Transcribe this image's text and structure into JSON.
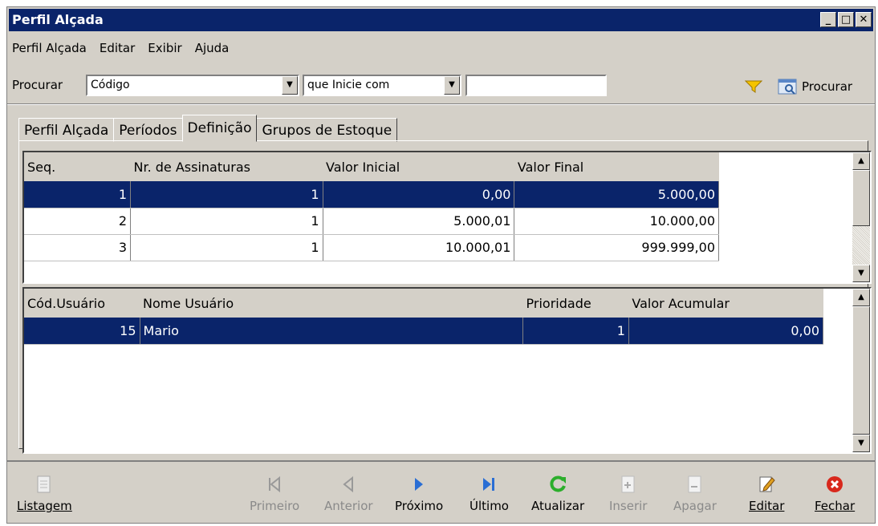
{
  "window": {
    "title": "Perfil Alçada"
  },
  "menu": {
    "items": [
      "Perfil Alçada",
      "Editar",
      "Exibir",
      "Ajuda"
    ]
  },
  "search": {
    "label": "Procurar",
    "field": "Código",
    "mode": "que Inicie com",
    "value": "",
    "button": "Procurar"
  },
  "tabs": [
    "Perfil Alçada",
    "Períodos",
    "Definição",
    "Grupos de Estoque"
  ],
  "active_tab": "Definição",
  "grid1": {
    "columns": [
      "Seq.",
      "Nr. de Assinaturas",
      "Valor Inicial",
      "Valor Final"
    ],
    "rows": [
      [
        "1",
        "1",
        "0,00",
        "5.000,00"
      ],
      [
        "2",
        "1",
        "5.000,01",
        "10.000,00"
      ],
      [
        "3",
        "1",
        "10.000,01",
        "999.999,00"
      ]
    ]
  },
  "grid2": {
    "columns": [
      "Cód.Usuário",
      "Nome Usuário",
      "Prioridade",
      "Valor Acumular"
    ],
    "rows": [
      [
        "15",
        "Mario",
        "1",
        "0,00"
      ]
    ]
  },
  "toolbar": {
    "listagem": "Listagem",
    "primeiro": "Primeiro",
    "anterior": "Anterior",
    "proximo": "Próximo",
    "ultimo": "Último",
    "atualizar": "Atualizar",
    "inserir": "Inserir",
    "apagar": "Apagar",
    "editar": "Editar",
    "fechar": "Fechar"
  },
  "colors": {
    "selection": "#0a246a",
    "face": "#d4d0c8"
  }
}
